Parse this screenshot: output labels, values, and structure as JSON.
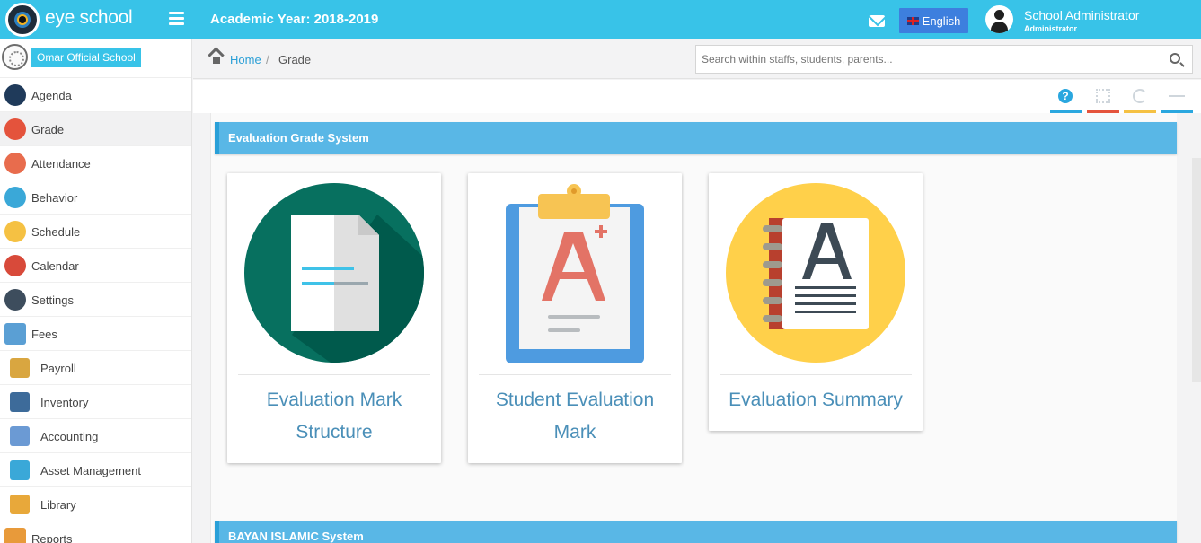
{
  "header": {
    "brand": "eye school",
    "academic_year": "Academic Year: 2018-2019",
    "language": "English",
    "user_name": "School Administrator",
    "user_role": "Administrator"
  },
  "sidebar": {
    "school_name": "Omar Official School",
    "items": [
      {
        "label": "Agenda",
        "icon": "agenda-icon",
        "color": "#1f3a5a"
      },
      {
        "label": "Grade",
        "icon": "grade-icon",
        "color": "#e4533c",
        "active": true
      },
      {
        "label": "Attendance",
        "icon": "attendance-icon",
        "color": "#e86c4d"
      },
      {
        "label": "Behavior",
        "icon": "behavior-icon",
        "color": "#3aa8d8"
      },
      {
        "label": "Schedule",
        "icon": "schedule-icon",
        "color": "#f5c143"
      },
      {
        "label": "Calendar",
        "icon": "calendar-icon",
        "color": "#d84a3a"
      },
      {
        "label": "Settings",
        "icon": "settings-icon",
        "color": "#3d4d5d"
      },
      {
        "label": "Fees",
        "icon": "fees-icon",
        "color": "#5a9fd4"
      },
      {
        "label": "Payroll",
        "icon": "payroll-icon",
        "color": "#d9a640"
      },
      {
        "label": "Inventory",
        "icon": "inventory-icon",
        "color": "#3d6b9a"
      },
      {
        "label": "Accounting",
        "icon": "accounting-icon",
        "color": "#6b9ad4"
      },
      {
        "label": "Asset Management",
        "icon": "asset-management-icon",
        "color": "#3aa8d8"
      },
      {
        "label": "Library",
        "icon": "library-icon",
        "color": "#e8a83a"
      },
      {
        "label": "Reports",
        "icon": "reports-icon",
        "color": "#e89a3a"
      }
    ]
  },
  "breadcrumb": {
    "home": "Home",
    "separator": "/",
    "current": "Grade"
  },
  "search": {
    "placeholder": "Search within staffs, students, parents..."
  },
  "toolbar": {
    "help": "?",
    "bar_colors": [
      "#2aa7df",
      "#e4533c",
      "#f5c143",
      "#2aa7df"
    ]
  },
  "sections": [
    {
      "title": "Evaluation Grade System"
    },
    {
      "title": "BAYAN ISLAMIC System"
    }
  ],
  "cards": [
    {
      "title": "Evaluation Mark Structure",
      "icon": "document-icon"
    },
    {
      "title": "Student Evaluation Mark",
      "icon": "clipboard-grade-icon"
    },
    {
      "title": "Evaluation Summary",
      "icon": "notebook-icon"
    }
  ],
  "colors": {
    "topbar": "#38c3e8",
    "section": "#59b7e6",
    "link": "#2a9fd6",
    "card_title": "#4a8fb8"
  }
}
